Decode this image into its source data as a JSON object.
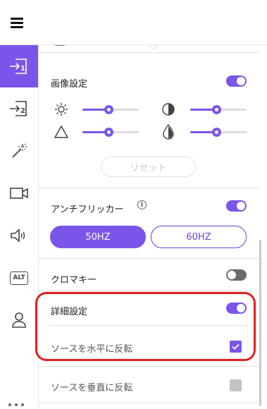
{
  "image_settings": {
    "title": "画像設定",
    "enabled": true,
    "sliders": [
      {
        "icon": "brightness-icon",
        "value": 0.46
      },
      {
        "icon": "contrast-icon",
        "value": 0.46
      },
      {
        "icon": "sharpness-icon",
        "value": 0.46
      },
      {
        "icon": "saturation-icon",
        "value": 0.46
      }
    ],
    "reset_label": "リセット"
  },
  "anti_flicker": {
    "title": "アンチフリッカー",
    "enabled": true,
    "options": [
      "50HZ",
      "60HZ"
    ],
    "selected": "50HZ"
  },
  "chroma_key": {
    "title": "クロマキー",
    "enabled": false
  },
  "advanced": {
    "title": "詳細設定",
    "enabled": true,
    "flip_horizontal_label": "ソースを水平に反転",
    "flip_horizontal_checked": true,
    "flip_vertical_label": "ソースを垂直に反転",
    "flip_vertical_checked": false
  },
  "sidebar": {
    "items": [
      {
        "icon": "source-1-icon",
        "active": true
      },
      {
        "icon": "source-2-icon",
        "active": false
      },
      {
        "icon": "magic-wand-icon",
        "active": false
      },
      {
        "icon": "camera-icon",
        "active": false
      },
      {
        "icon": "speaker-icon",
        "active": false
      },
      {
        "icon": "alt-text-icon",
        "label": "ALT",
        "active": false
      },
      {
        "icon": "user-icon",
        "active": false
      }
    ]
  },
  "colors": {
    "accent": "#7b55e8",
    "highlight_border": "#e02020"
  }
}
